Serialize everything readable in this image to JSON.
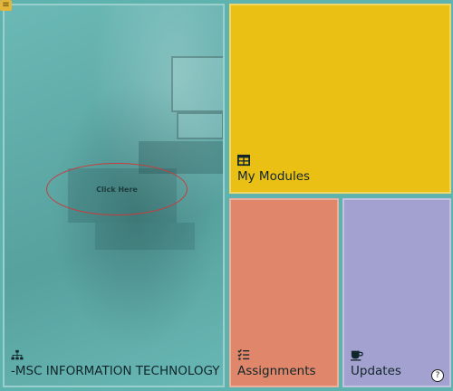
{
  "menu": {
    "icon": "hamburger-icon"
  },
  "course_tile": {
    "label": "-MSC INFORMATION TECHNOLOGY",
    "icon": "sitemap-icon",
    "callout": "Click Here",
    "color": "#63b5b2"
  },
  "modules_tile": {
    "label": "My Modules",
    "icon": "table-icon",
    "color": "#ebc015"
  },
  "assignments_tile": {
    "label": "Assignments",
    "icon": "task-list-icon",
    "color": "#e0866a"
  },
  "updates_tile": {
    "label": "Updates",
    "icon": "coffee-cup-icon",
    "help": "?",
    "color": "#a3a1cf"
  }
}
